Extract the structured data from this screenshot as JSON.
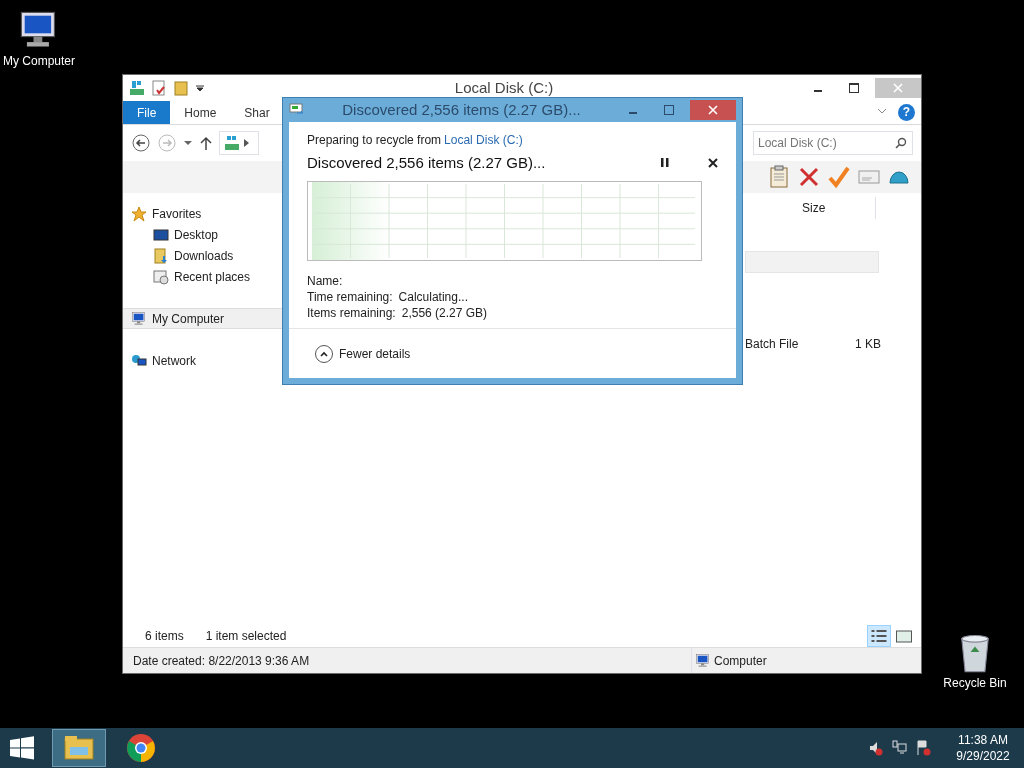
{
  "desktop_icons": [
    {
      "label": "My Computer",
      "kind": "computer"
    },
    {
      "label": "Recycle Bin",
      "kind": "recycle"
    }
  ],
  "explorer": {
    "title": "Local Disk (C:)",
    "ribbon_tabs": [
      {
        "label": "File",
        "kind": "file"
      },
      {
        "label": "Home",
        "kind": "tab"
      },
      {
        "label": "Shar",
        "kind": "tab"
      }
    ],
    "help": "?",
    "search": {
      "placeholder": "Local Disk (C:)"
    },
    "columns": [
      "Size"
    ],
    "nav": [
      {
        "label": "Favorites",
        "kind": "star",
        "selected": false,
        "children": [
          {
            "label": "Desktop",
            "kind": "desktop",
            "selected": false
          },
          {
            "label": "Downloads",
            "kind": "downloads",
            "selected": false
          },
          {
            "label": "Recent places",
            "kind": "recent",
            "selected": false
          }
        ]
      },
      {
        "label": "My Computer",
        "kind": "computer",
        "selected": true
      },
      {
        "label": "Network",
        "kind": "network",
        "selected": false
      }
    ],
    "rows": [
      {
        "type": "Batch File",
        "size": "1 KB"
      }
    ],
    "status": {
      "count": "6 items",
      "selection": "1 item selected"
    },
    "views": [
      {
        "kind": "details",
        "selected": true
      },
      {
        "kind": "thumbnails",
        "selected": false
      }
    ],
    "details_pane": {
      "date_created": "Date created: 8/22/2013 9:36 AM",
      "location": "Computer"
    }
  },
  "dialog": {
    "title": "Discovered 2,556 items (2.27 GB)...",
    "source_label": "Preparing to recycle from",
    "source_link": "Local Disk (C:)",
    "heading": "Discovered 2,556 items (2.27 GB)...",
    "rows": [
      {
        "label": "Name:"
      },
      {
        "label": "Time remaining:",
        "value": "Calculating..."
      },
      {
        "label": "Items remaining:",
        "value": "2,556 (2.27 GB)"
      }
    ],
    "toggle": "Fewer details"
  },
  "taskbar": {
    "apps": [
      {
        "kind": "explorer",
        "selected": true
      },
      {
        "kind": "chrome",
        "selected": false
      }
    ],
    "time": "11:38 AM",
    "date": "9/29/2022"
  }
}
